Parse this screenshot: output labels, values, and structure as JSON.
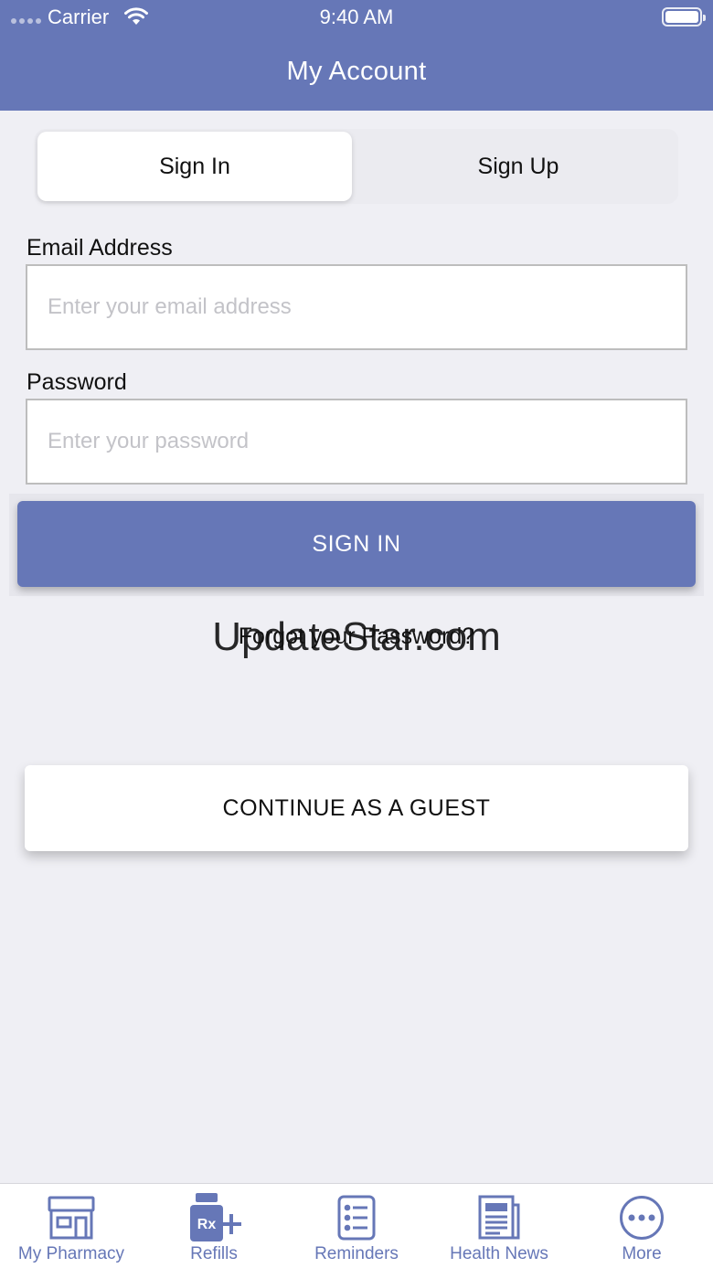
{
  "status_bar": {
    "carrier": "Carrier",
    "time": "9:40 AM"
  },
  "header": {
    "title": "My Account"
  },
  "segmented": {
    "sign_in": "Sign In",
    "sign_up": "Sign Up",
    "selected": "Sign In"
  },
  "form": {
    "email_label": "Email Address",
    "email_placeholder": "Enter your email address",
    "password_label": "Password",
    "password_placeholder": "Enter your password",
    "sign_in_button": "SIGN IN",
    "forgot_password": "Forgot your Password?"
  },
  "guest_button": "CONTINUE AS A GUEST",
  "watermark": "UpdateStar.com",
  "tabs": [
    {
      "label": "My Pharmacy",
      "icon": "pharmacy-store-icon"
    },
    {
      "label": "Refills",
      "icon": "rx-refill-icon"
    },
    {
      "label": "Reminders",
      "icon": "reminders-list-icon"
    },
    {
      "label": "Health News",
      "icon": "newspaper-icon"
    },
    {
      "label": "More",
      "icon": "more-dots-icon"
    }
  ],
  "colors": {
    "primary": "#6677b7",
    "background": "#efeff4",
    "tab_icon": "#6677b7"
  }
}
